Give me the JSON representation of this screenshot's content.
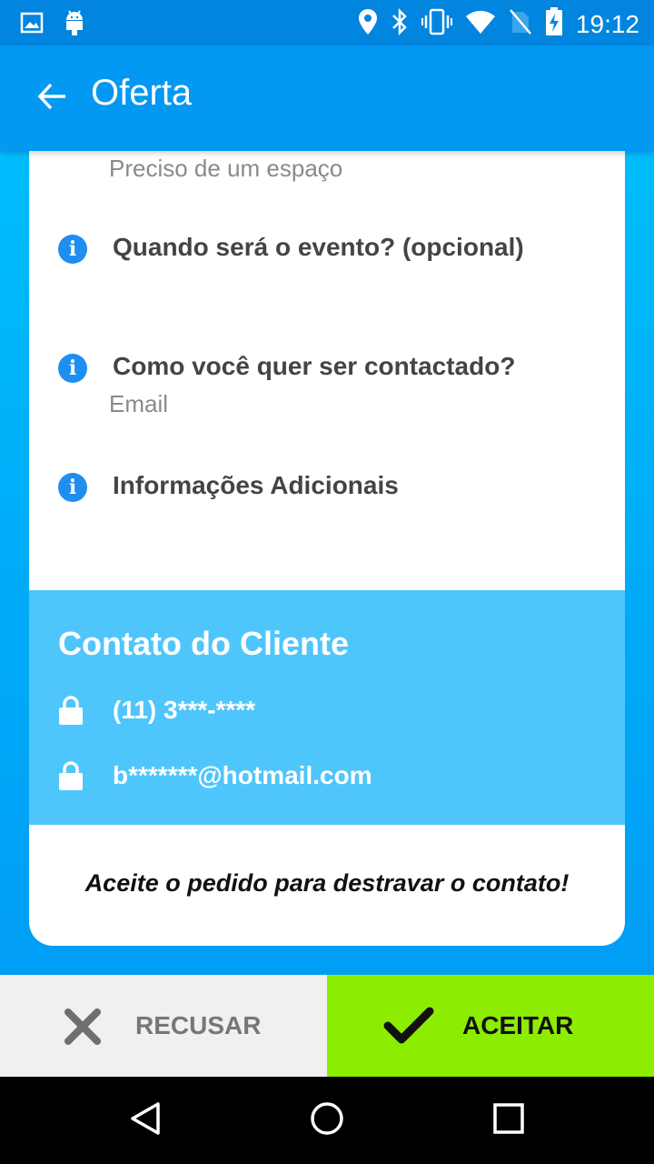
{
  "status_bar": {
    "time": "19:12",
    "icons": [
      "image-icon",
      "android-icon",
      "location-icon",
      "bluetooth-icon",
      "vibrate-icon",
      "wifi-icon",
      "no-sim-icon",
      "battery-charging-icon"
    ]
  },
  "app_bar": {
    "title": "Oferta",
    "back_icon": "arrow-left-icon"
  },
  "questions": {
    "partial_answer": "Preciso de um espaço",
    "items": [
      {
        "question": "Quando será o evento? (opcional)",
        "answer": ""
      },
      {
        "question": "Como você quer ser contactado?",
        "answer": "Email"
      },
      {
        "question": "Informações Adicionais",
        "answer": ""
      }
    ]
  },
  "contact": {
    "title": "Contato do Cliente",
    "phone": "(11) 3***-****",
    "email": "b*******@hotmail.com"
  },
  "unlock_message": "Aceite o pedido para destravar o contato!",
  "actions": {
    "reject_label": "RECUSAR",
    "accept_label": "ACEITAR"
  },
  "colors": {
    "app_bar": "#0398f2",
    "status_bar": "#0185de",
    "contact_box": "#4fc6fb",
    "accept": "#8ded00",
    "reject": "#f0f0f0",
    "info_icon": "#1e8ef0"
  }
}
